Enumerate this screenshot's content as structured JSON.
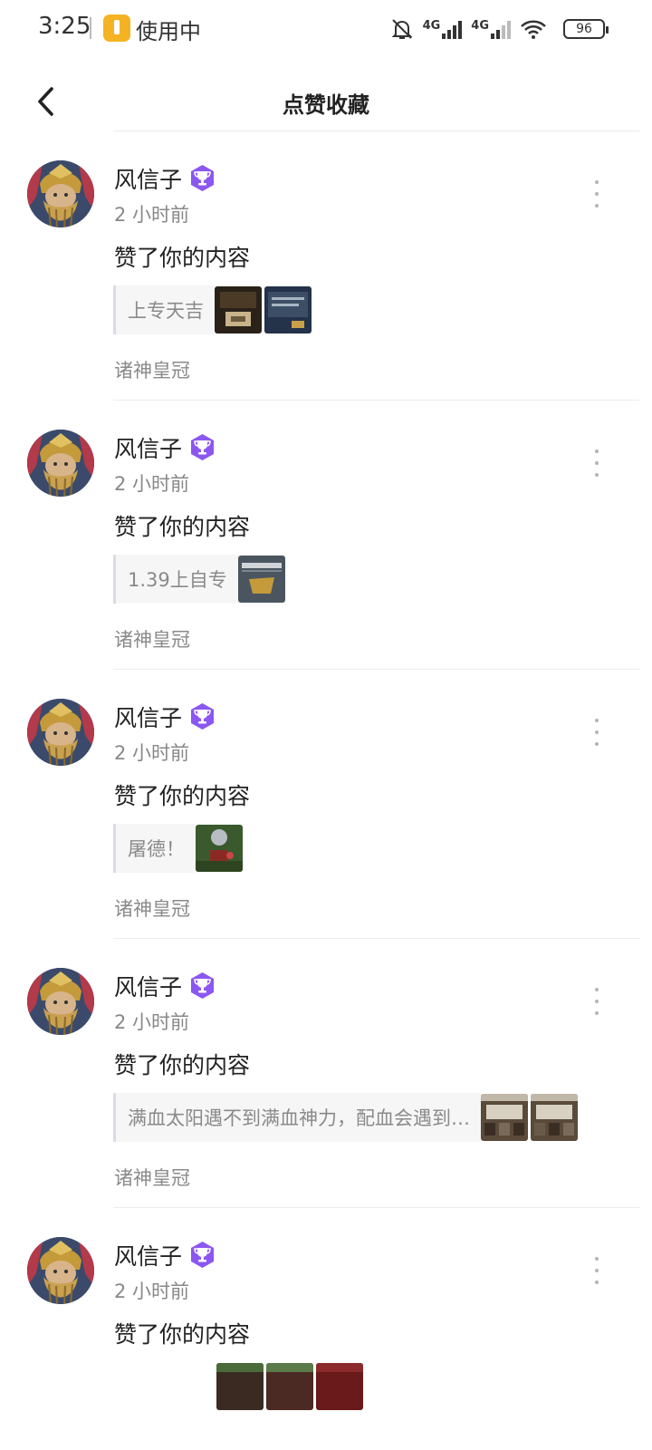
{
  "status_bar": {
    "time": "3:25",
    "app_in_use": "使用中",
    "network_1": "4G",
    "network_2": "4G",
    "battery": "96"
  },
  "header": {
    "title": "点赞收藏"
  },
  "items": [
    {
      "username": "",
      "time": "",
      "action": "",
      "quote": "",
      "category": "诸神皇冠",
      "thumbnails": []
    },
    {
      "username": "风信子",
      "time": "2 小时前",
      "action": "赞了你的内容",
      "quote": "上专天吉",
      "category": "诸神皇冠",
      "thumbnails": [
        "game-screenshot-1",
        "game-screenshot-2"
      ]
    },
    {
      "username": "风信子",
      "time": "2 小时前",
      "action": "赞了你的内容",
      "quote": "1.39上自专",
      "category": "诸神皇冠",
      "thumbnails": [
        "game-screenshot-3"
      ]
    },
    {
      "username": "风信子",
      "time": "2 小时前",
      "action": "赞了你的内容",
      "quote": "屠德！",
      "category": "诸神皇冠",
      "thumbnails": [
        "game-screenshot-4"
      ]
    },
    {
      "username": "风信子",
      "time": "2 小时前",
      "action": "赞了你的内容",
      "quote": "满血太阳遇不到满血神力，配血会遇到…",
      "category": "诸神皇冠",
      "thumbnails": [
        "game-screenshot-5",
        "game-screenshot-6"
      ]
    },
    {
      "username": "风信子",
      "time": "2 小时前",
      "action": "赞了你的内容",
      "quote": "",
      "category": "",
      "thumbnails": [
        "game-screenshot-7",
        "game-screenshot-8",
        "game-screenshot-9"
      ]
    }
  ]
}
